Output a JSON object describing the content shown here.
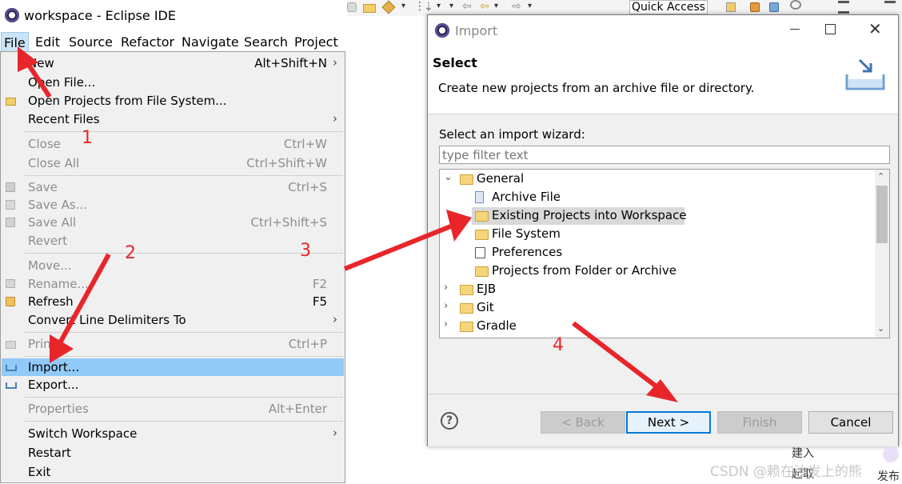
{
  "window": {
    "title": "workspace - Eclipse IDE"
  },
  "menubar": [
    "File",
    "Edit",
    "Source",
    "Refactor",
    "Navigate",
    "Search",
    "Project"
  ],
  "file_menu": [
    {
      "label": "New",
      "shortcut": "Alt+Shift+N",
      "submenu": true,
      "disabled": false
    },
    {
      "label": "Open File...",
      "shortcut": "",
      "submenu": false,
      "disabled": false
    },
    {
      "label": "Open Projects from File System...",
      "shortcut": "",
      "submenu": false,
      "disabled": false
    },
    {
      "label": "Recent Files",
      "shortcut": "",
      "submenu": true,
      "disabled": false
    },
    {
      "label": "Close",
      "shortcut": "Ctrl+W",
      "submenu": false,
      "disabled": true
    },
    {
      "label": "Close All",
      "shortcut": "Ctrl+Shift+W",
      "submenu": false,
      "disabled": true
    },
    {
      "label": "Save",
      "shortcut": "Ctrl+S",
      "submenu": false,
      "disabled": true
    },
    {
      "label": "Save As...",
      "shortcut": "",
      "submenu": false,
      "disabled": true
    },
    {
      "label": "Save All",
      "shortcut": "Ctrl+Shift+S",
      "submenu": false,
      "disabled": true
    },
    {
      "label": "Revert",
      "shortcut": "",
      "submenu": false,
      "disabled": true
    },
    {
      "label": "Move...",
      "shortcut": "",
      "submenu": false,
      "disabled": true
    },
    {
      "label": "Rename...",
      "shortcut": "F2",
      "submenu": false,
      "disabled": true
    },
    {
      "label": "Refresh",
      "shortcut": "F5",
      "submenu": false,
      "disabled": false
    },
    {
      "label": "Convert Line Delimiters To",
      "shortcut": "",
      "submenu": true,
      "disabled": false
    },
    {
      "label": "Print...",
      "shortcut": "Ctrl+P",
      "submenu": false,
      "disabled": true
    },
    {
      "label": "Import...",
      "shortcut": "",
      "submenu": false,
      "disabled": false,
      "highlighted": true
    },
    {
      "label": "Export...",
      "shortcut": "",
      "submenu": false,
      "disabled": false
    },
    {
      "label": "Properties",
      "shortcut": "Alt+Enter",
      "submenu": false,
      "disabled": true
    },
    {
      "label": "Switch Workspace",
      "shortcut": "",
      "submenu": true,
      "disabled": false
    },
    {
      "label": "Restart",
      "shortcut": "",
      "submenu": false,
      "disabled": false
    },
    {
      "label": "Exit",
      "shortcut": "",
      "submenu": false,
      "disabled": false
    }
  ],
  "toolbar": {
    "quick_access": "Quick Access"
  },
  "dialog": {
    "title": "Import",
    "header_title": "Select",
    "header_desc": "Create new projects from an archive file or directory.",
    "wizard_label": "Select an import wizard:",
    "filter_placeholder": "type filter text",
    "tree": [
      {
        "label": "General",
        "level": 0,
        "expanded": true
      },
      {
        "label": "Archive File",
        "level": 1
      },
      {
        "label": "Existing Projects into Workspace",
        "level": 1,
        "selected": true
      },
      {
        "label": "File System",
        "level": 1
      },
      {
        "label": "Preferences",
        "level": 1
      },
      {
        "label": "Projects from Folder or Archive",
        "level": 1
      },
      {
        "label": "EJB",
        "level": 0,
        "expanded": false
      },
      {
        "label": "Git",
        "level": 0,
        "expanded": false
      },
      {
        "label": "Gradle",
        "level": 0,
        "expanded": false
      }
    ],
    "buttons": {
      "back": "< Back",
      "next": "Next >",
      "finish": "Finish",
      "cancel": "Cancel",
      "help": "?"
    }
  },
  "annotations": [
    "1",
    "2",
    "3",
    "4"
  ],
  "background_fragments": [
    "建入",
    "起取",
    "发布"
  ],
  "watermark": "CSDN @赖在沙发上的熊",
  "colors": {
    "highlight": "#91c9f7",
    "arrow": "#e8262a",
    "default_button_border": "#0078d7"
  }
}
